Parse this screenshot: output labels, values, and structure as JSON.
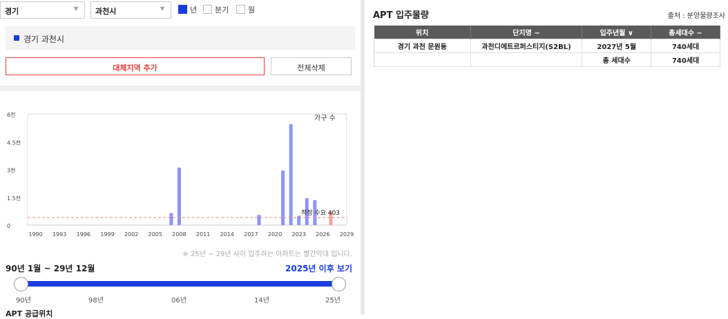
{
  "filters": {
    "region_select": "경기",
    "city_select": "과천시",
    "periods": [
      {
        "label": "년",
        "checked": true
      },
      {
        "label": "분기",
        "checked": false
      },
      {
        "label": "월",
        "checked": false
      }
    ]
  },
  "region_chip": "경기 과천시",
  "buttons": {
    "add_region": "대체지역 추가",
    "delete_all": "전체삭제"
  },
  "chart_data": {
    "type": "bar",
    "legend": "가구 수",
    "x_ticks": [
      "1990",
      "1993",
      "1996",
      "1999",
      "2002",
      "2005",
      "2008",
      "2011",
      "2014",
      "2017",
      "2020",
      "2023",
      "2026",
      "2029"
    ],
    "y_ticks": [
      "6천",
      "4.5천",
      "3천",
      "1.5천",
      "0"
    ],
    "ylim": [
      0,
      6000
    ],
    "xlim": [
      1989,
      2029
    ],
    "series": [
      {
        "color": "#8c94f2",
        "points": [
          [
            2007,
            650
          ],
          [
            2008,
            3100
          ],
          [
            2018,
            550
          ],
          [
            2021,
            2950
          ],
          [
            2022,
            5450
          ],
          [
            2023,
            500
          ],
          [
            2024,
            1450
          ],
          [
            2025,
            1350
          ]
        ]
      },
      {
        "color": "#f4a6a0",
        "points": [
          [
            2027,
            740
          ]
        ]
      }
    ],
    "reference_line": {
      "label": "적정 수요 403",
      "value": 403,
      "color": "#f08a82"
    }
  },
  "note": "※ 25년 ~ 29년 사이 입주하는 아파트는 빨간막대 입니다.",
  "period_label": "90년 1월 ~ 29년 12월",
  "after_link": "2025년 이후 보기",
  "slider_ticks": [
    "90년",
    "98년",
    "06년",
    "14년",
    "25년"
  ],
  "section_title": "APT 공급위치",
  "apt": {
    "title": "APT 입주물량",
    "source": "출처 : 분양물량조사",
    "headers": [
      "위치",
      "단지명 −",
      "입주년월 ∨",
      "총세대수 −"
    ],
    "rows": [
      [
        "경기 과천 문원동",
        "과천디에트르퍼스티지(S2BL)",
        "2027년 5월",
        "740세대"
      ],
      [
        "",
        "",
        "총 세대수",
        "740세대"
      ]
    ]
  },
  "colors": {
    "accent": "#1a3cdf",
    "red": "#e0413a"
  }
}
